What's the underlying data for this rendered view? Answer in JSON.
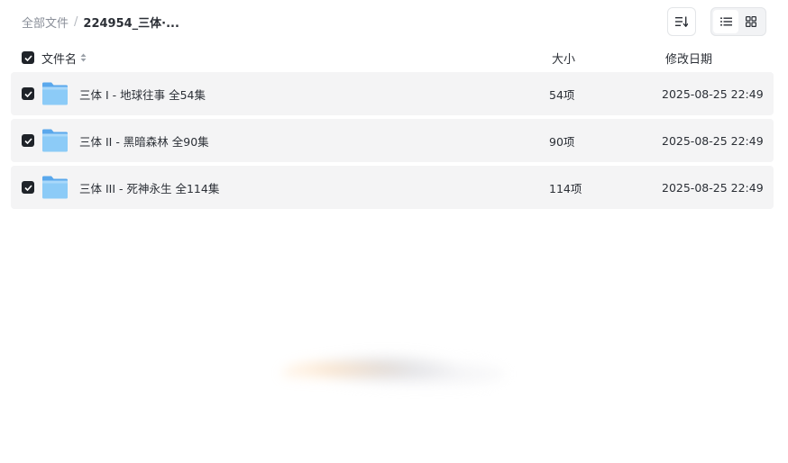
{
  "breadcrumb": {
    "root": "全部文件",
    "separator": "/",
    "current": "224954_三体·..."
  },
  "toolbar": {
    "sort_icon": "sort-list-icon",
    "view_list_icon": "list-view-icon",
    "view_grid_icon": "grid-view-icon",
    "active_view": "list"
  },
  "columns": {
    "name": "文件名",
    "size": "大小",
    "date": "修改日期"
  },
  "files": [
    {
      "name": "三体 I - 地球往事 全54集",
      "size": "54项",
      "date": "2025-08-25 22:49",
      "checked": true,
      "icon": "folder-icon"
    },
    {
      "name": "三体 II - 黑暗森林 全90集",
      "size": "90项",
      "date": "2025-08-25 22:49",
      "checked": true,
      "icon": "folder-icon"
    },
    {
      "name": "三体 III - 死神永生 全114集",
      "size": "114项",
      "date": "2025-08-25 22:49",
      "checked": true,
      "icon": "folder-icon"
    }
  ],
  "colors": {
    "row_background": "#f4f4f5",
    "checkbox": "#1f2329",
    "folder": "#7cc0f5"
  }
}
